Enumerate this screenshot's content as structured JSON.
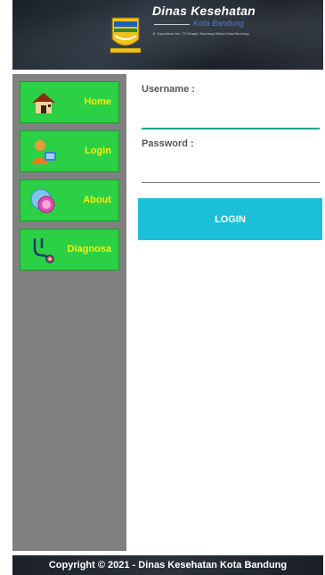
{
  "header": {
    "title": "Dinas Kesehatan",
    "city": "Kota Bandung",
    "address": "Jl. Supratman No. 73 Cihapit, Bandung Wetan Kota Bandung"
  },
  "sidebar": {
    "items": [
      {
        "label": "Home",
        "icon": "house-icon"
      },
      {
        "label": "Login",
        "icon": "user-login-icon"
      },
      {
        "label": "About",
        "icon": "about-icon"
      },
      {
        "label": "Diagnosa",
        "icon": "stethoscope-icon"
      }
    ]
  },
  "form": {
    "username_label": "Username :",
    "username_value": "",
    "password_label": "Password :",
    "password_value": "",
    "login_label": "LOGIN"
  },
  "footer": {
    "copyright": "Copyright © 2021 - Dinas Kesehatan Kota Bandung"
  },
  "colors": {
    "menu_bg": "#2cd044",
    "menu_text": "#ffee00",
    "sidebar_bg": "#808080",
    "button_bg": "#1cbfd8",
    "input_focus_line": "#10a897"
  }
}
